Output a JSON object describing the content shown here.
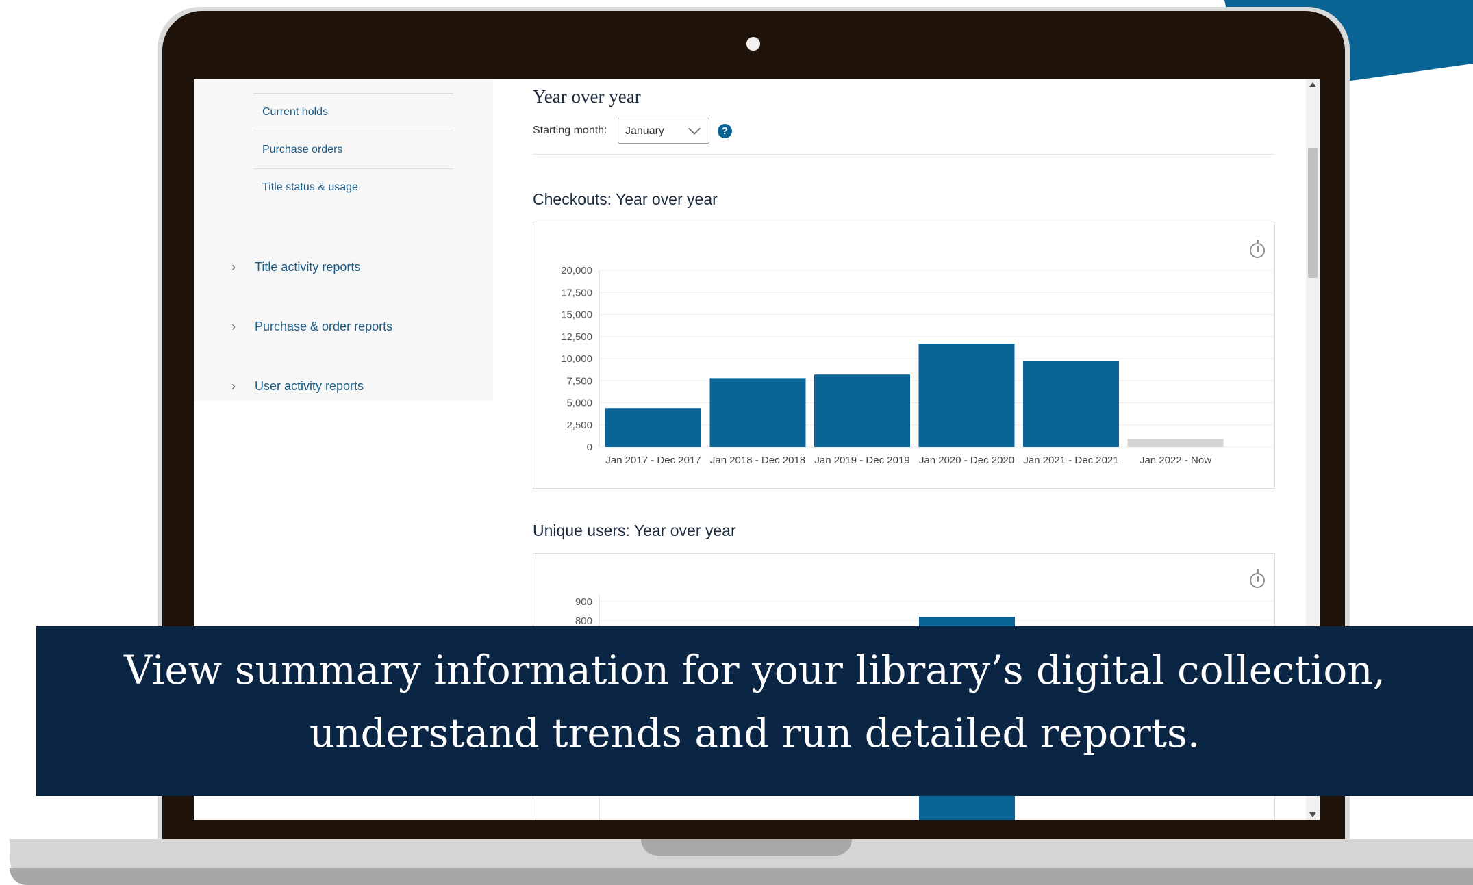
{
  "sidebar": {
    "sub_items": [
      "Current holds",
      "Purchase orders",
      "Title status & usage"
    ],
    "groups": [
      "Title activity reports",
      "Purchase & order reports",
      "User activity reports"
    ]
  },
  "main": {
    "section_title": "Year over year",
    "starting_month_label": "Starting month:",
    "starting_month_value": "January",
    "help_label": "?"
  },
  "chart_data": [
    {
      "type": "bar",
      "title": "Checkouts: Year over year",
      "categories": [
        "Jan 2017 - Dec 2017",
        "Jan 2018 - Dec 2018",
        "Jan 2019 - Dec 2019",
        "Jan 2020 - Dec 2020",
        "Jan 2021 - Dec 2021",
        "Jan 2022 - Now"
      ],
      "values": [
        4400,
        7800,
        8200,
        11700,
        9700,
        900
      ],
      "ylim": [
        0,
        20000
      ],
      "yticks": [
        "0",
        "2,500",
        "5,000",
        "7,500",
        "10,000",
        "12,500",
        "15,000",
        "17,500",
        "20,000"
      ],
      "bar_color": "#0a6596",
      "last_bar_color": "#d4d4d4"
    },
    {
      "type": "bar",
      "title": "Unique users: Year over year",
      "visible_yticks": [
        "900",
        "800"
      ],
      "visible_bar_tops": [
        820
      ]
    }
  ],
  "banner": {
    "line1": "View summary information for your library’s digital collection,",
    "line2": "understand trends and run detailed reports."
  },
  "colors": {
    "accent": "#0a6596",
    "banner_bg": "#0b2545"
  }
}
